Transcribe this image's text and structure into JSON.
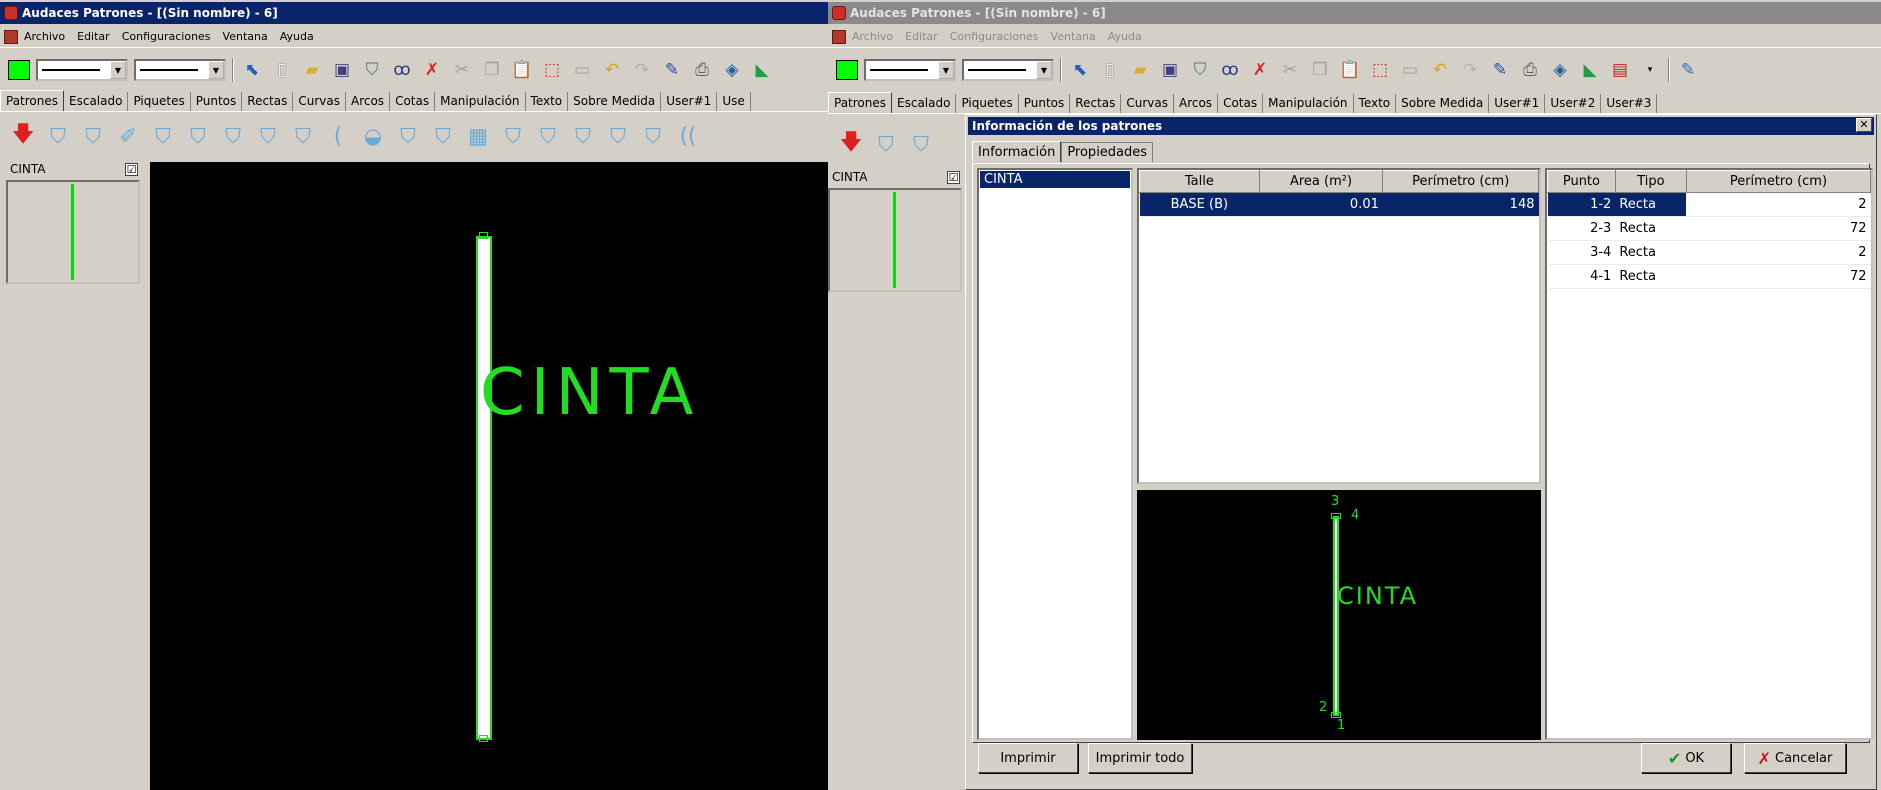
{
  "app": {
    "title": "Audaces Patrones - [(Sin nombre) - 6]",
    "menu": [
      "Archivo",
      "Editar",
      "Configuraciones",
      "Ventana",
      "Ayuda"
    ],
    "tabs": [
      "Patrones",
      "Escalado",
      "Piquetes",
      "Puntos",
      "Rectas",
      "Curvas",
      "Arcos",
      "Cotas",
      "Manipulación",
      "Texto",
      "Sobre Medida",
      "User#1",
      "User#2",
      "User#3"
    ],
    "tabs_left_visible": [
      "Patrones",
      "Escalado",
      "Piquetes",
      "Puntos",
      "Rectas",
      "Curvas",
      "Arcos",
      "Cotas",
      "Manipulación",
      "Texto",
      "Sobre Medida",
      "User#1",
      "Use"
    ],
    "active_tab": "Patrones",
    "colors": {
      "title_active": "#0a246a",
      "piece_stroke": "#22dd22",
      "current_color": "#00ff00"
    }
  },
  "pieces": {
    "name": "CINTA",
    "checked": "☑"
  },
  "canvas": {
    "piece_label": "CINTA"
  },
  "dialog": {
    "title": "Información de los patrones",
    "close": "✕",
    "tabs": [
      "Información",
      "Propiedades"
    ],
    "patterns": [
      "CINTA"
    ],
    "sizes_table": {
      "columns": [
        "Talle",
        "Area (m²)",
        "Perímetro (cm)"
      ],
      "rows": [
        {
          "talle": "BASE (B)",
          "area": "0.01",
          "perimetro": "148"
        }
      ]
    },
    "segments_table": {
      "columns": [
        "Punto",
        "Tipo",
        "Perímetro (cm)"
      ],
      "rows": [
        {
          "punto": "1-2",
          "tipo": "Recta",
          "perimetro": "2"
        },
        {
          "punto": "2-3",
          "tipo": "Recta",
          "perimetro": "72"
        },
        {
          "punto": "3-4",
          "tipo": "Recta",
          "perimetro": "2"
        },
        {
          "punto": "4-1",
          "tipo": "Recta",
          "perimetro": "72"
        }
      ]
    },
    "preview": {
      "label": "CINTA",
      "points": [
        "1",
        "2",
        "3",
        "4"
      ]
    },
    "buttons": {
      "print": "Imprimir",
      "print_all": "Imprimir todo",
      "ok": "OK",
      "cancel": "Cancelar"
    }
  }
}
